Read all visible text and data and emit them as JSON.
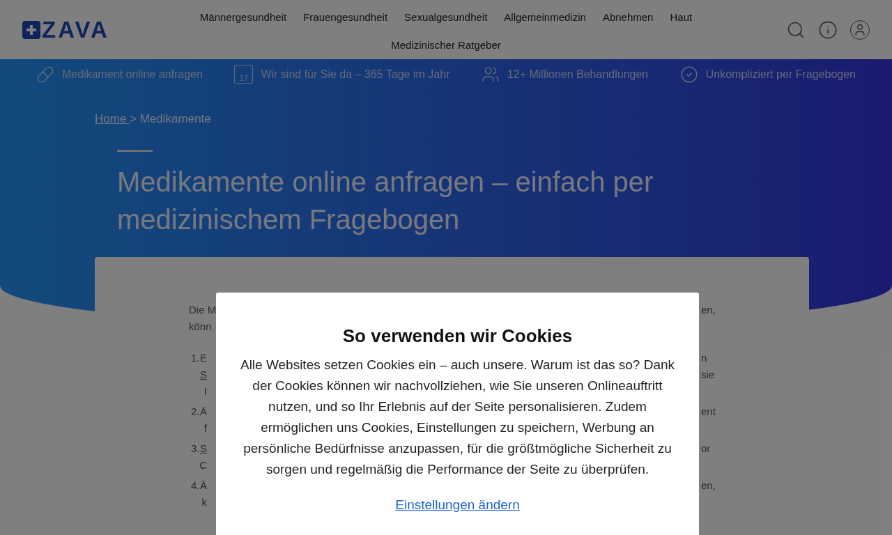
{
  "header": {
    "logo": "ZAVA",
    "nav": [
      "Männergesundheit",
      "Frauengesundheit",
      "Sexualgesundheit",
      "Allgemeinmedizin",
      "Abnehmen",
      "Haut",
      "Medizinischer Ratgeber"
    ]
  },
  "features": [
    {
      "kind": "pill",
      "label": "Medikament online anfragen"
    },
    {
      "kind": "calendar",
      "icon_text": "17",
      "label": "Wir sind für Sie da – 365 Tage im Jahr"
    },
    {
      "kind": "people",
      "label": "12+ Millionen Behandlungen"
    },
    {
      "kind": "check",
      "label": "Unkompliziert per Fragebogen"
    }
  ],
  "breadcrumb": {
    "link": "Home ",
    "current": "> Medikamente"
  },
  "title": "Medikamente online anfragen – einfach per medizinischem Fragebogen",
  "content": {
    "intro": [
      {
        "left": "Die M",
        "right": "en,"
      },
      {
        "left": "könn"
      }
    ],
    "items": [
      {
        "number": "1.",
        "lines": [
          {
            "kind": "text",
            "left": "E",
            "right": "n"
          },
          {
            "kind": "link",
            "left": "S",
            "right": "sie"
          },
          {
            "kind": "text",
            "left": "I"
          }
        ]
      },
      {
        "number": "2.",
        "lines": [
          {
            "kind": "text",
            "left": "Ä",
            "right": "ent"
          },
          {
            "kind": "text",
            "left": "f"
          }
        ]
      },
      {
        "number": "3.",
        "lines": [
          {
            "kind": "link",
            "left": "S",
            "right": "or"
          },
          {
            "kind": "text",
            "left": "C"
          }
        ]
      },
      {
        "number": "4.",
        "lines": [
          {
            "kind": "text",
            "left": "Ä",
            "right": "en,"
          },
          {
            "kind": "text",
            "left": "k"
          }
        ]
      }
    ]
  },
  "cookie_dialog": {
    "title": "So verwenden wir Cookies",
    "text": "Alle Websites setzen Cookies ein – auch unsere. Warum ist das so? Dank der Cookies können wir nachvollziehen, wie Sie unseren Onlineauftritt nutzen, und so Ihr Erlebnis auf der Seite personalisieren. Zudem ermöglichen uns Cookies, Einstellungen zu speichern, Werbung an persönliche Bedürfnisse anzupassen, für die größtmögliche Sicherheit zu sorgen und regelmäßig die Performance der Seite zu überprüfen.",
    "link": "Einstellungen ändern"
  }
}
